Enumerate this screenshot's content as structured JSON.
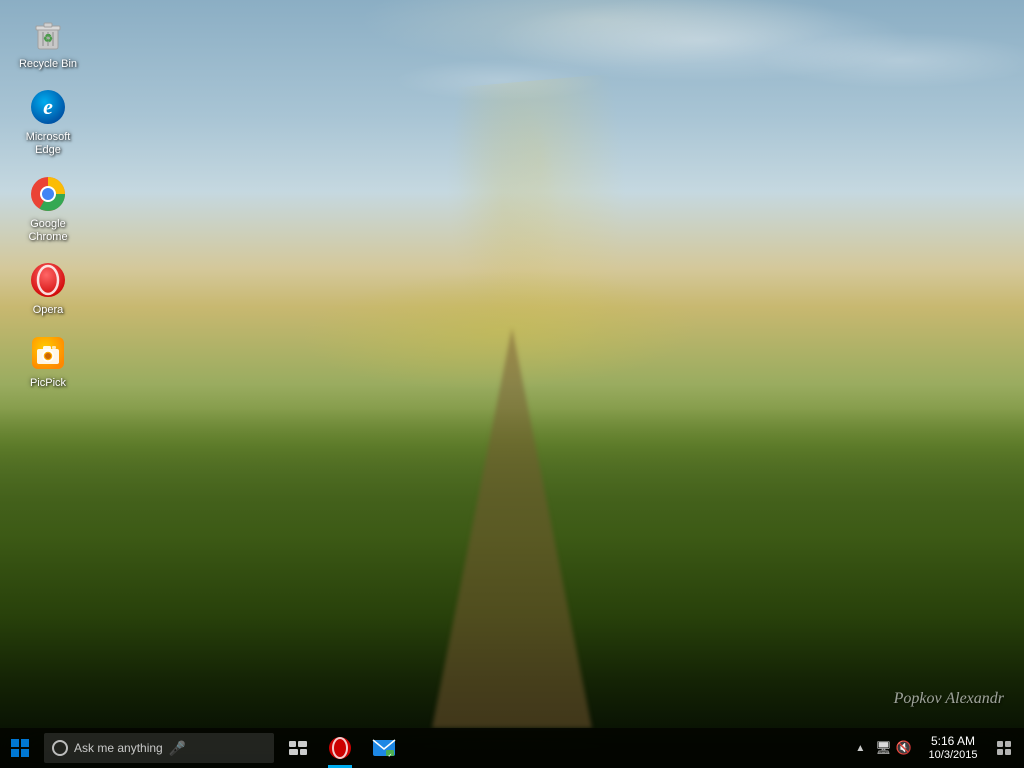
{
  "desktop": {
    "icons": [
      {
        "id": "recycle-bin",
        "label": "Recycle Bin",
        "type": "recycle"
      },
      {
        "id": "microsoft-edge",
        "label": "Microsoft Edge",
        "type": "edge"
      },
      {
        "id": "google-chrome",
        "label": "Google Chrome",
        "type": "chrome"
      },
      {
        "id": "opera",
        "label": "Opera",
        "type": "opera"
      },
      {
        "id": "picpick",
        "label": "PicPick",
        "type": "picpick"
      }
    ],
    "watermark": "Popkov Alexandr"
  },
  "taskbar": {
    "search_placeholder": "Ask me anything",
    "time": "5:16 AM",
    "date": "10/3/2015",
    "apps": [
      {
        "id": "opera-taskbar",
        "label": "Opera"
      },
      {
        "id": "mail-taskbar",
        "label": "Mail"
      }
    ]
  }
}
